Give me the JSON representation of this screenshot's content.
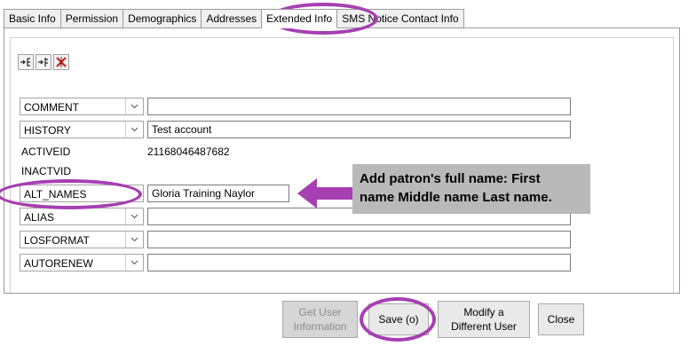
{
  "tabs": [
    {
      "label": "Basic Info"
    },
    {
      "label": "Permission"
    },
    {
      "label": "Demographics"
    },
    {
      "label": "Addresses"
    },
    {
      "label": "Extended Info",
      "active": true
    },
    {
      "label": "SMS Notice Contact Info"
    }
  ],
  "fields": {
    "comment": {
      "key": "COMMENT",
      "value": ""
    },
    "history": {
      "key": "HISTORY",
      "value": "Test account"
    },
    "activeid": {
      "key": "ACTIVEID",
      "value": "21168046487682"
    },
    "inactvid": {
      "key": "INACTVID",
      "value": ""
    },
    "alt_names": {
      "key": "ALT_NAMES",
      "value": "Gloria Training Naylor"
    },
    "alias": {
      "key": "ALIAS",
      "value": ""
    },
    "losformat": {
      "key": "LOSFORMAT",
      "value": ""
    },
    "autorenew": {
      "key": "AUTORENEW",
      "value": ""
    }
  },
  "callout": {
    "line1": "Add patron's full name: First",
    "line2": "name Middle name Last name."
  },
  "buttons": {
    "get_user_line1": "Get User",
    "get_user_line2": "Information",
    "save": "Save (o)",
    "modify_line1": "Modify a",
    "modify_line2": "Different User",
    "close": "Close"
  },
  "colors": {
    "highlight": "#a63fb2",
    "arrow": "#a63fb2",
    "callout_bg": "#b9b9b9",
    "remove_icon": "#d21f1f"
  },
  "icons": {
    "toolbar": [
      "add-field-icon",
      "insert-field-icon",
      "remove-field-icon"
    ]
  }
}
